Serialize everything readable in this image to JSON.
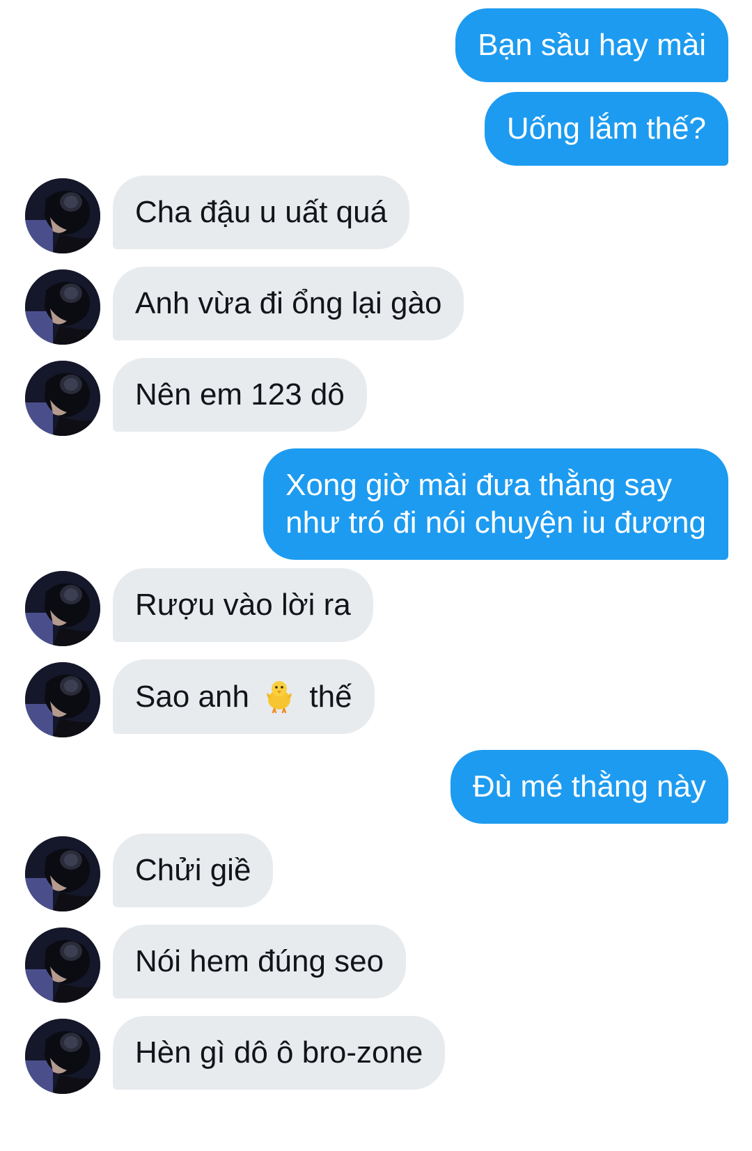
{
  "colors": {
    "outgoing_bubble": "#1d9bf0",
    "incoming_bubble": "#e8ebee",
    "outgoing_text": "#ffffff",
    "incoming_text": "#111418"
  },
  "messages": [
    {
      "direction": "out",
      "text": "Bạn sầu hay mài"
    },
    {
      "direction": "out",
      "text": "Uống lắm thế?"
    },
    {
      "direction": "in",
      "text": "Cha đậu u uất quá",
      "avatar": "avatar"
    },
    {
      "direction": "in",
      "text": "Anh vừa đi ổng lại gào",
      "avatar": "avatar"
    },
    {
      "direction": "in",
      "text": "Nên em 123 dô",
      "avatar": "avatar"
    },
    {
      "direction": "out",
      "lines": [
        "Xong giờ mài đưa thằng say",
        "như tró đi nói chuyện iu đương"
      ]
    },
    {
      "direction": "in",
      "text": "Rượu vào lời ra",
      "avatar": "avatar"
    },
    {
      "direction": "in",
      "text_before": "Sao anh",
      "emoji": "baby-chick-icon",
      "text_after": "thế",
      "avatar": "avatar"
    },
    {
      "direction": "out",
      "text": "Đù mé thằng này"
    },
    {
      "direction": "in",
      "text": "Chửi giề",
      "avatar": "avatar"
    },
    {
      "direction": "in",
      "text": "Nói hem đúng seo",
      "avatar": "avatar"
    },
    {
      "direction": "in",
      "text": "Hèn gì dô ô bro-zone",
      "avatar": "avatar"
    }
  ]
}
